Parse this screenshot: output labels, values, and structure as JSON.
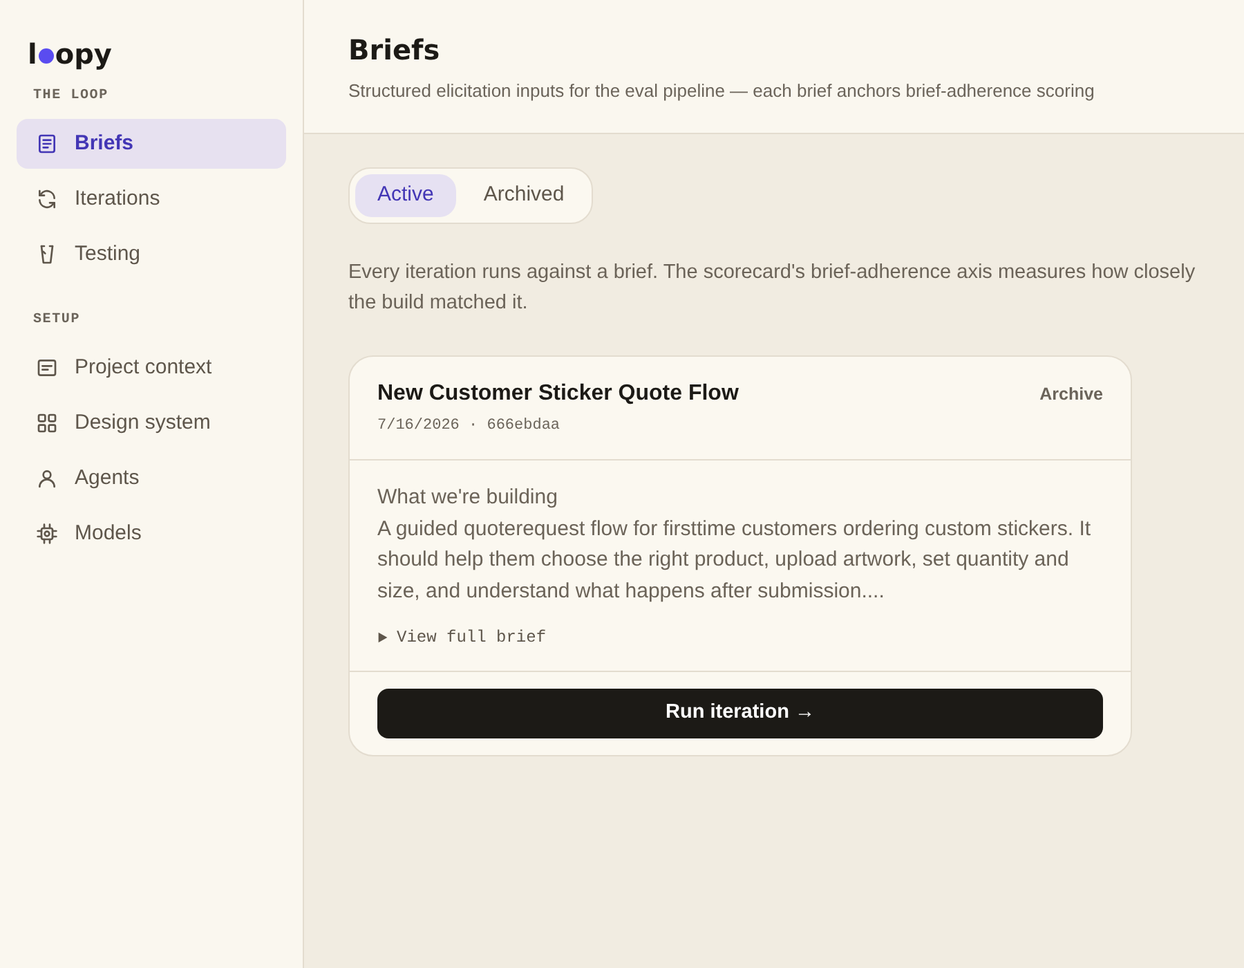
{
  "sidebar": {
    "logo": {
      "prefix": "l",
      "suffix": "opy"
    },
    "sections": [
      {
        "title": "THE LOOP",
        "items": [
          {
            "label": "Briefs",
            "selected": true
          },
          {
            "label": "Iterations",
            "selected": false
          },
          {
            "label": "Testing",
            "selected": false
          }
        ]
      },
      {
        "title": "SETUP",
        "items": [
          {
            "label": "Project context",
            "selected": false
          },
          {
            "label": "Design system",
            "selected": false
          },
          {
            "label": "Agents",
            "selected": false
          },
          {
            "label": "Models",
            "selected": false
          }
        ]
      }
    ]
  },
  "header": {
    "title": "Briefs",
    "subtitle": "Structured elicitation inputs for the eval pipeline — each brief anchors brief-adherence scoring"
  },
  "tabs": [
    {
      "label": "Active",
      "selected": true
    },
    {
      "label": "Archived",
      "selected": false
    }
  ],
  "intro": "Every iteration runs against a brief. The scorecard's brief-adherence axis measures how closely the build matched it.",
  "briefs": [
    {
      "title": "New Customer Sticker Quote Flow",
      "meta": "7/16/2026 · 666ebdaa",
      "action": "Archive",
      "heading": "What we're building",
      "summary": "A guided quoterequest flow for firsttime customers ordering custom stickers. It should help them choose the right product, upload artwork, set quantity and size, and understand what happens after submission....",
      "toggle": "View full brief",
      "expanded": false,
      "button": "Run iteration →"
    }
  ]
}
